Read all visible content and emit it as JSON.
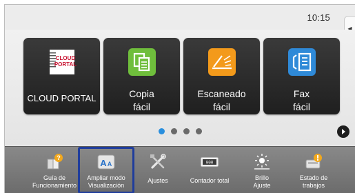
{
  "status": {
    "time": "10:15"
  },
  "tiles": [
    {
      "label_lines": [
        "CLOUD PORTAL"
      ],
      "icon": "cloud-portal-icon",
      "logo_text": [
        "CLOUD",
        "PORTAL"
      ]
    },
    {
      "label_lines": [
        "Copia",
        "fácil"
      ],
      "icon": "copy-icon"
    },
    {
      "label_lines": [
        "Escaneado",
        "fácil"
      ],
      "icon": "scan-icon"
    },
    {
      "label_lines": [
        "Fax",
        "fácil"
      ],
      "icon": "fax-icon"
    }
  ],
  "pager": {
    "pages": 4,
    "active": 1
  },
  "quick_bar": [
    {
      "label_lines": [
        "Guía de",
        "Funcionamiento"
      ],
      "icon": "help-guide-icon"
    },
    {
      "label_lines": [
        "Ampliar modo",
        "Visualización"
      ],
      "icon": "enlarge-display-icon",
      "selected": true
    },
    {
      "label_lines": [
        "Ajustes"
      ],
      "icon": "settings-tools-icon"
    },
    {
      "label_lines": [
        "Contador total"
      ],
      "icon": "total-counter-icon",
      "counter_text": "000"
    },
    {
      "label_lines": [
        "Brillo",
        "Ajuste"
      ],
      "icon": "brightness-icon"
    },
    {
      "label_lines": [
        "Estado de",
        "trabajos"
      ],
      "icon": "job-status-icon"
    }
  ],
  "colors": {
    "selected_outline": "#1f3d9c",
    "active_dot": "#2a8fde",
    "tile_bg": "#2b2b2b"
  }
}
